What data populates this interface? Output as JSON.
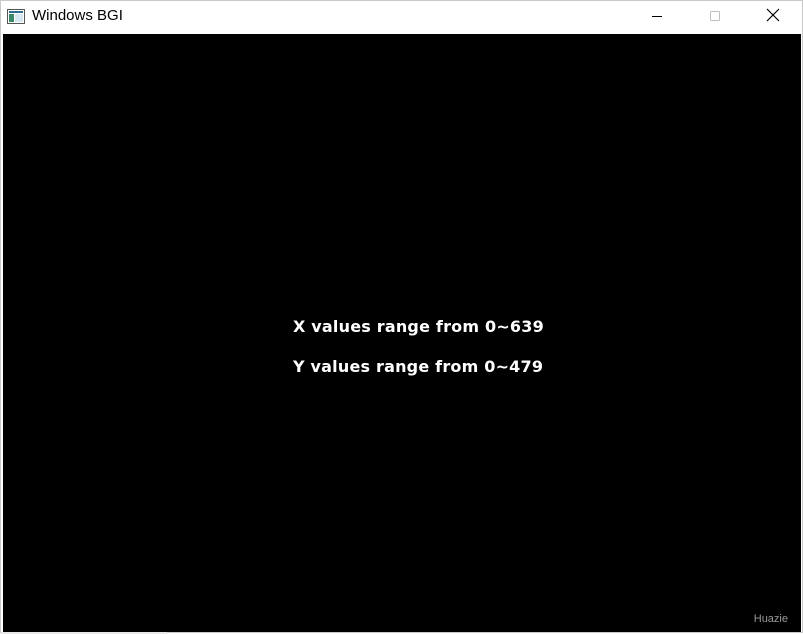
{
  "window": {
    "title": "Windows BGI",
    "app_icon": "bgi-window-icon",
    "controls": {
      "minimize_icon": "minimize-icon",
      "maximize_icon": "maximize-icon",
      "close_icon": "close-icon"
    }
  },
  "canvas": {
    "background": "#000000",
    "text_color": "#ffffff",
    "lines": [
      "X values range from 0~639",
      "Y values range from 0~479"
    ]
  },
  "watermark": {
    "text": "Huazie"
  }
}
